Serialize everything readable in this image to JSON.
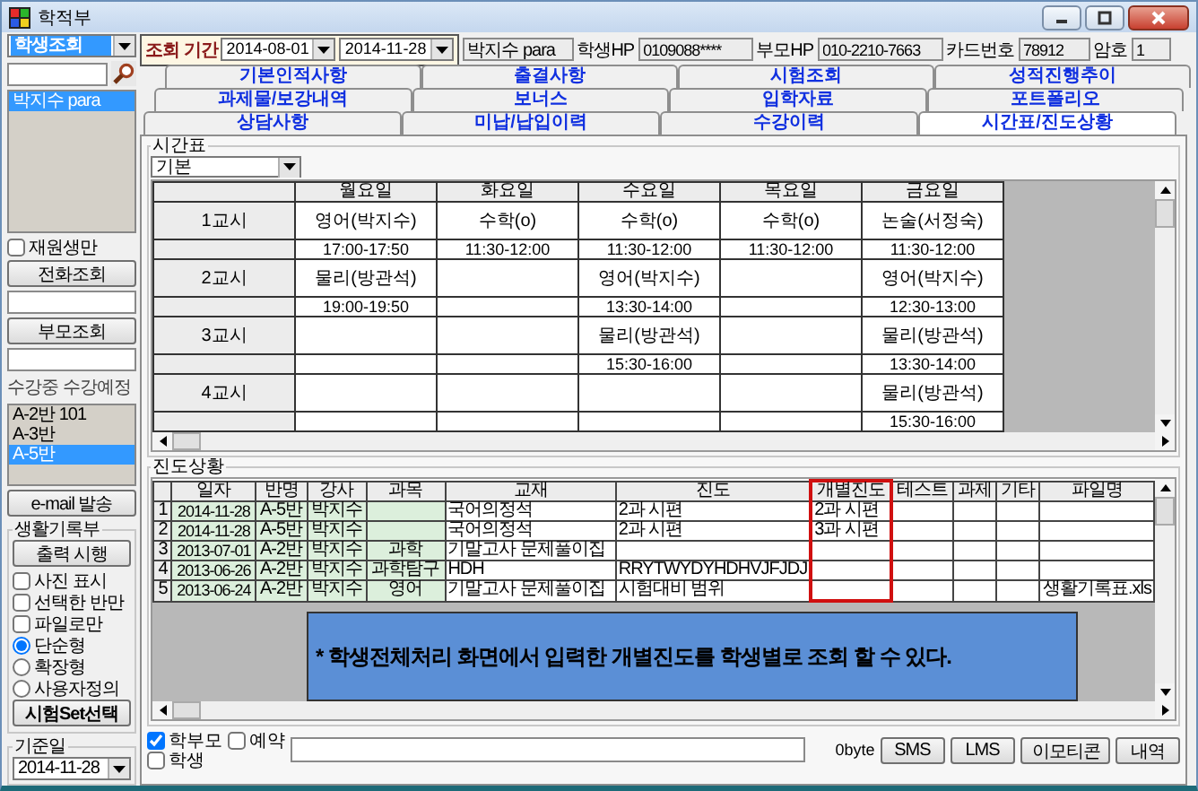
{
  "window": {
    "title": "학적부"
  },
  "left_panel": {
    "mode": "학생조회",
    "students": [
      {
        "label": "박지수 para",
        "selected": true
      }
    ],
    "enrolled_only": {
      "label": "재원생만",
      "checked": false
    },
    "phone_button": "전화조회",
    "parent_button": "부모조회",
    "class_list_label": "수강중 수강예정",
    "classes": [
      {
        "label": "A-2반 101",
        "selected": false
      },
      {
        "label": "A-3반",
        "selected": false
      },
      {
        "label": "A-5반",
        "selected": true
      }
    ],
    "email_button": "e-mail 발송",
    "record_group": {
      "title": "생활기록부",
      "print_button": "출력 시행",
      "options": [
        {
          "kind": "checkbox",
          "label": "사진 표시",
          "checked": false
        },
        {
          "kind": "checkbox",
          "label": "선택한 반만",
          "checked": false
        },
        {
          "kind": "checkbox",
          "label": "파일로만",
          "checked": false
        },
        {
          "kind": "radio",
          "label": "단순형",
          "selected": true
        },
        {
          "kind": "radio",
          "label": "확장형",
          "selected": false
        },
        {
          "kind": "radio",
          "label": "사용자정의",
          "selected": false
        }
      ],
      "test_set_button": "시험Set선택"
    },
    "base_date": {
      "title": "기준일",
      "value": "2014-11-28"
    }
  },
  "header": {
    "period_label": "조회 기간",
    "date_from": "2014-08-01",
    "date_to": "2014-11-28",
    "name": "박지수 para",
    "fields": [
      {
        "label": "학생HP",
        "value": "0109088****"
      },
      {
        "label": "부모HP",
        "value": "010-2210-7663"
      },
      {
        "label": "카드번호",
        "value": "78912"
      },
      {
        "label": "암호",
        "value": "1"
      }
    ]
  },
  "tab_rows": [
    {
      "tabs": [
        {
          "label": "기본인적사항",
          "selected": false
        },
        {
          "label": "출결사항",
          "selected": false
        },
        {
          "label": "시험조회",
          "selected": false
        },
        {
          "label": "성적진행추이",
          "selected": false
        }
      ]
    },
    {
      "tabs": [
        {
          "label": "과제물/보강내역",
          "selected": false
        },
        {
          "label": "보너스",
          "selected": false
        },
        {
          "label": "입학자료",
          "selected": false
        },
        {
          "label": "포트폴리오",
          "selected": false
        }
      ]
    },
    {
      "tabs": [
        {
          "label": "상담사항",
          "selected": false
        },
        {
          "label": "미납/납입이력",
          "selected": false
        },
        {
          "label": "수강이력",
          "selected": false
        },
        {
          "label": "시간표/진도상황",
          "selected": true
        }
      ]
    }
  ],
  "timetable": {
    "title": "시간표",
    "view": "기본",
    "days": [
      "월요일",
      "화요일",
      "수요일",
      "목요일",
      "금요일"
    ],
    "periods": [
      {
        "label": "1교시",
        "slots": [
          {
            "kind": "lesson",
            "class": "영어(박지수)",
            "time": "17:00-17:50"
          },
          {
            "kind": "lesson",
            "class": "수학(o)",
            "time": "11:30-12:00"
          },
          {
            "kind": "lesson",
            "class": "수학(o)",
            "time": "11:30-12:00"
          },
          {
            "kind": "lesson",
            "class": "수학(o)",
            "time": "11:30-12:00"
          },
          {
            "kind": "lesson",
            "class": "논술(서정숙)",
            "time": "11:30-12:00"
          }
        ]
      },
      {
        "label": "2교시",
        "slots": [
          {
            "kind": "lesson",
            "class": "물리(방관석)",
            "time": "19:00-19:50"
          },
          {
            "kind": "empty"
          },
          {
            "kind": "lesson",
            "class": "영어(박지수)",
            "time": "13:30-14:00"
          },
          {
            "kind": "empty"
          },
          {
            "kind": "lesson",
            "class": "영어(박지수)",
            "time": "12:30-13:00"
          }
        ]
      },
      {
        "label": "3교시",
        "slots": [
          {
            "kind": "empty"
          },
          {
            "kind": "empty"
          },
          {
            "kind": "lesson",
            "class": "물리(방관석)",
            "time": "15:30-16:00"
          },
          {
            "kind": "empty"
          },
          {
            "kind": "lesson",
            "class": "물리(방관석)",
            "time": "13:30-14:00"
          }
        ]
      },
      {
        "label": "4교시",
        "slots": [
          {
            "kind": "empty"
          },
          {
            "kind": "empty"
          },
          {
            "kind": "empty"
          },
          {
            "kind": "empty"
          },
          {
            "kind": "lesson",
            "class": "물리(방관석)",
            "time": "15:30-16:00"
          }
        ]
      }
    ]
  },
  "progress": {
    "title": "진도상황",
    "columns": [
      {
        "label": "일자",
        "kind": "locked",
        "highlighted": false
      },
      {
        "label": "반명",
        "kind": "locked",
        "highlighted": false
      },
      {
        "label": "강사",
        "kind": "locked",
        "highlighted": false
      },
      {
        "label": "과목",
        "kind": "locked",
        "highlighted": false
      },
      {
        "label": "교재",
        "kind": "normal",
        "highlighted": false
      },
      {
        "label": "진도",
        "kind": "normal",
        "highlighted": false
      },
      {
        "label": "개별진도",
        "kind": "normal",
        "highlighted": true
      },
      {
        "label": "테스트",
        "kind": "normal",
        "highlighted": false
      },
      {
        "label": "과제",
        "kind": "normal",
        "highlighted": false
      },
      {
        "label": "기타",
        "kind": "normal",
        "highlighted": false
      },
      {
        "label": "파일명",
        "kind": "normal",
        "highlighted": false
      }
    ],
    "rows": [
      {
        "number": "1",
        "cells": [
          "2014-11-28",
          "A-5반",
          "박지수",
          null,
          "국어의정석",
          "2과 시편",
          "2과 시편",
          null,
          null,
          null,
          null
        ]
      },
      {
        "number": "2",
        "cells": [
          "2014-11-28",
          "A-5반",
          "박지수",
          null,
          "국어의정석",
          "2과 시편",
          "3과 시편",
          null,
          null,
          null,
          null
        ]
      },
      {
        "number": "3",
        "cells": [
          "2013-07-01",
          "A-2반",
          "박지수",
          "과학",
          "기말고사 문제풀이집",
          null,
          null,
          null,
          null,
          null,
          null
        ]
      },
      {
        "number": "4",
        "cells": [
          "2013-06-26",
          "A-2반",
          "박지수",
          "과학탐구",
          "HDH",
          "RRYTWYDYHDHVJFJDJ",
          null,
          null,
          null,
          null,
          null
        ]
      },
      {
        "number": "5",
        "cells": [
          "2013-06-24",
          "A-2반",
          "박지수",
          "영어",
          "기말고사 문제풀이집",
          "시험대비 범위",
          null,
          null,
          null,
          null,
          "생활기록표.xls"
        ]
      }
    ],
    "note": "* 학생전체처리 화면에서 입력한 개별진도를 학생별로 조회 할 수 있다."
  },
  "message_bar": {
    "recipients": [
      {
        "label": "학부모",
        "checked": true
      },
      {
        "label": "학생",
        "checked": false
      }
    ],
    "reserve": {
      "label": "예약",
      "checked": false
    },
    "byte_count": "0byte",
    "buttons": [
      "SMS",
      "LMS",
      "이모티콘",
      "내역"
    ]
  }
}
